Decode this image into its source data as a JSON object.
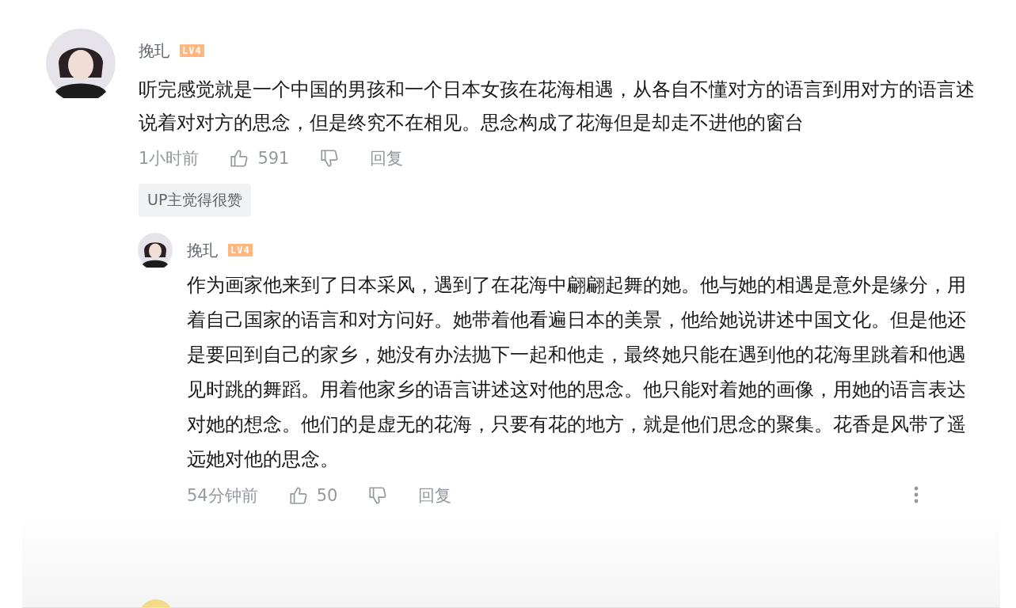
{
  "comment": {
    "author": "挽玌",
    "level": "LV4",
    "text": "听完感觉就是一个中国的男孩和一个日本女孩在花海相遇，从各自不懂对方的语言到用对方的语言述说着对对方的思念，但是终究不在相见。思念构成了花海但是却走不进他的窗台",
    "time": "1小时前",
    "likes": "591",
    "reply_label": "回复",
    "up_badge": "UP主觉得很赞",
    "replies": [
      {
        "author": "挽玌",
        "level": "LV4",
        "text": "作为画家他来到了日本采风，遇到了在花海中翩翩起舞的她。他与她的相遇是意外是缘分，用着自己国家的语言和对方问好。她带着他看遍日本的美景，他给她说讲述中国文化。但是他还是要回到自己的家乡，她没有办法抛下一起和他走，最终她只能在遇到他的花海里跳着和他遇见时跳的舞蹈。用着他家乡的语言讲述这对他的思念。他只能对着她的画像，用她的语言表达对她的想念。他们的是虚无的花海，只要有花的地方，就是他们思念的聚集。花香是风带了遥远她对他的思念。",
        "time": "54分钟前",
        "likes": "50",
        "reply_label": "回复"
      }
    ]
  }
}
